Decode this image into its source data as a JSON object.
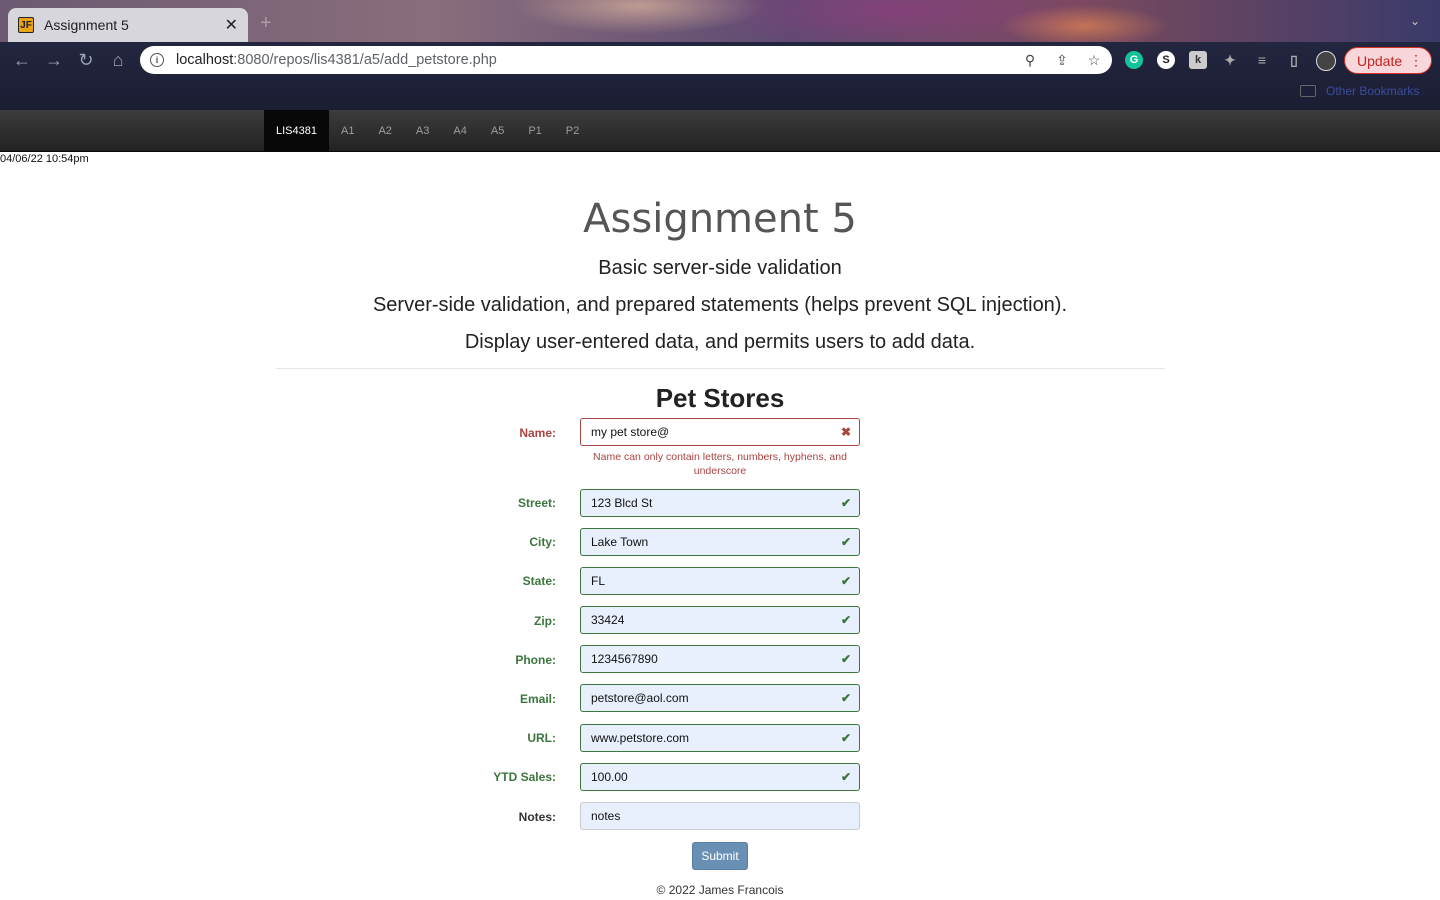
{
  "browser": {
    "tab_title": "Assignment 5",
    "favicon_text": "JF",
    "url_host": "localhost",
    "url_path": ":8080/repos/lis4381/a5/add_petstore.php",
    "update_label": "Update",
    "bookmarks_label": "Other Bookmarks"
  },
  "navbar": {
    "items": [
      "LIS4381",
      "A1",
      "A2",
      "A3",
      "A4",
      "A5",
      "P1",
      "P2"
    ],
    "active": "LIS4381"
  },
  "datetime": "04/06/22 10:54pm",
  "header": {
    "title": "Assignment 5",
    "lines": [
      "Basic server-side validation",
      "Server-side validation, and prepared statements (helps prevent SQL injection).",
      "Display user-entered data, and permits users to add data."
    ]
  },
  "form": {
    "title": "Pet Stores",
    "fields": [
      {
        "label": "Name:",
        "value": "my pet store@",
        "status": "error"
      },
      {
        "label": "Street:",
        "value": "123 Blcd St",
        "status": "ok"
      },
      {
        "label": "City:",
        "value": "Lake Town",
        "status": "ok"
      },
      {
        "label": "State:",
        "value": "FL",
        "status": "ok"
      },
      {
        "label": "Zip:",
        "value": "33424",
        "status": "ok"
      },
      {
        "label": "Phone:",
        "value": "1234567890",
        "status": "ok"
      },
      {
        "label": "Email:",
        "value": "petstore@aol.com",
        "status": "ok"
      },
      {
        "label": "URL:",
        "value": "www.petstore.com",
        "status": "ok"
      },
      {
        "label": "YTD Sales:",
        "value": "100.00",
        "status": "ok"
      },
      {
        "label": "Notes:",
        "value": "notes",
        "status": "none"
      }
    ],
    "name_error": "Name can only contain letters, numbers, hyphens, and underscore",
    "submit_label": "Submit"
  },
  "footer": "© 2022 James Francois",
  "colors": {
    "valid": "#3c763d",
    "error": "#a94442",
    "submit": "#6a8fb4"
  }
}
